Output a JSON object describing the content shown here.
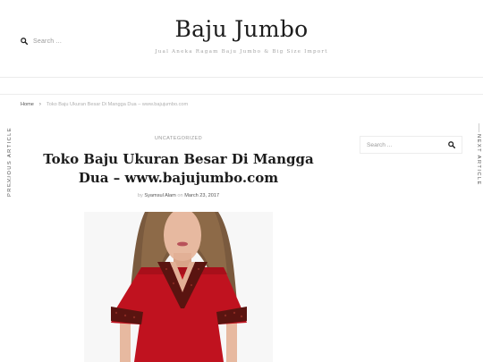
{
  "header": {
    "search_placeholder": "Search ...",
    "site_title": "Baju Jumbo",
    "tagline": "Jual Aneka Ragam Baju Jumbo & Big Size Import"
  },
  "breadcrumb": {
    "home": "Home",
    "separator": "›",
    "current": "Toko Baju Ukuran Besar Di Mangga Dua – www.bajujumbo.com"
  },
  "post_nav": {
    "previous": "Previous Article",
    "next": "Next Article"
  },
  "post": {
    "category": "Uncategorized",
    "title": "Toko Baju Ukuran Besar Di Mangga Dua – www.bajujumbo.com",
    "meta_by": "by",
    "author": "Syamsul Alam",
    "meta_on": "on",
    "date": "March 23, 2017"
  },
  "sidebar": {
    "search_placeholder": "Search ..."
  },
  "icons": {
    "header_search": "search-icon",
    "sidebar_search": "search-icon"
  },
  "colors": {
    "dress": "#c0121f",
    "sequin_trim": "#5a1410",
    "text_dark": "#1c1c1c",
    "text_muted": "#9a9a9a"
  }
}
